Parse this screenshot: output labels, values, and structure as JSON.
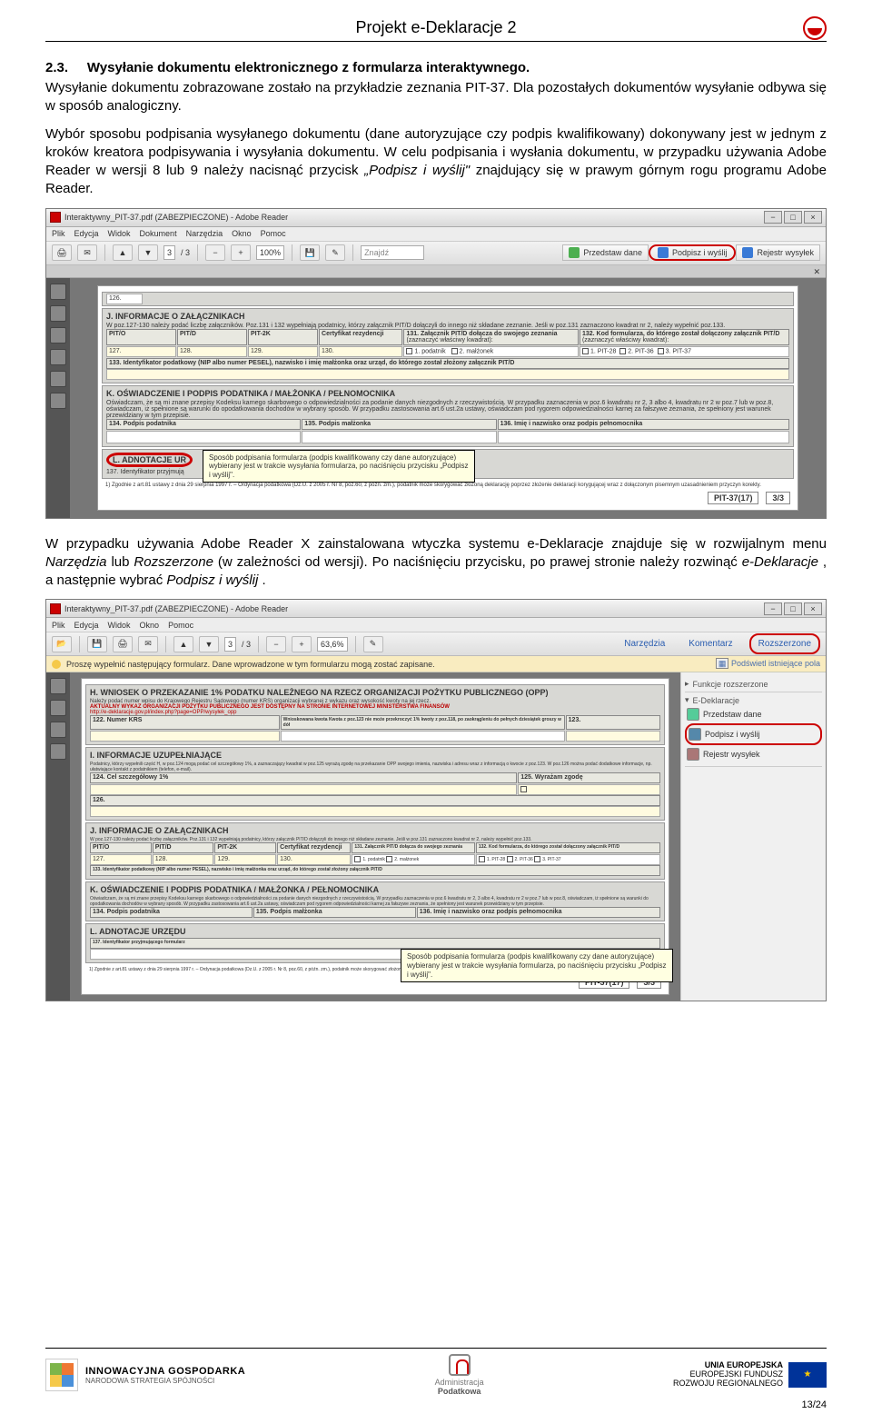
{
  "header": {
    "title": "Projekt e-Deklaracje 2"
  },
  "section": {
    "number": "2.3.",
    "title": "Wysyłanie dokumentu elektronicznego z formularza interaktywnego."
  },
  "para1": "Wysyłanie dokumentu zobrazowane zostało na przykładzie zeznania PIT-37. Dla pozostałych dokumentów wysyłanie odbywa się w sposób analogiczny.",
  "para2_a": "Wybór sposobu podpisania wysyłanego dokumentu (dane autoryzujące czy podpis kwalifikowany) dokonywany jest w jednym z kroków kreatora podpisywania i wysyłania dokumentu. W celu podpisania i wysłania dokumentu, w przypadku używania Adobe Reader w wersji 8 lub 9 należy nacisnąć przycisk ",
  "para2_b": " znajdujący się w prawym górnym rogu programu Adobe Reader.",
  "para2_italic": "„Podpisz i wyślij\"",
  "para3_a": "W przypadku używania Adobe Reader X zainstalowana wtyczka systemu e-Deklaracje znajduje się w rozwijalnym menu ",
  "para3_na": "Narzędzia",
  "para3_b": " lub ",
  "para3_ro": "Rozszerzone",
  "para3_c": " (w zależności od wersji). Po naciśnięciu przycisku, po prawej stronie należy rozwinąć ",
  "para3_ed": "e-Deklaracje",
  "para3_d": ", a następnie wybrać ",
  "para3_pw": "Podpisz i wyślij",
  "para3_e": ".",
  "app1": {
    "title": "Interaktywny_PIT-37.pdf (ZABEZPIECZONE) - Adobe Reader",
    "menu": [
      "Plik",
      "Edycja",
      "Widok",
      "Dokument",
      "Narzędzia",
      "Okno",
      "Pomoc"
    ],
    "page_cur": "3",
    "page_total": "/ 3",
    "zoom": "100%",
    "find": "Znajdź",
    "chips": {
      "przedstaw": "Przedstaw dane",
      "podpisz": "Podpisz i wyślij",
      "rejestr": "Rejestr wysyłek"
    },
    "cell126": "126.",
    "secJ_hd": "J. INFORMACJE O ZAŁĄCZNIKACH",
    "secJ_sub": "W poz.127-130 należy podać liczbę załączników. Poz.131 i 132 wypełniają podatnicy, którzy załącznik PIT/D dołączyli do innego niż składane zeznanie. Jeśli w poz.131 zaznaczono kwadrat nr 2, należy wypełnić poz.133.",
    "j_cells": {
      "pito": "PIT/O",
      "pitd": "PIT/D",
      "pit2k": "PIT-2K",
      "cert": "Certyfikat rezydencji",
      "c131": "131. Załącznik PIT/D dołącza do swojego zeznania",
      "c131s": "(zaznaczyć właściwy kwadrat):",
      "c132": "132. Kod formularza, do którego został dołączony załącznik PIT/D",
      "c132s": "(zaznaczyć właściwy kwadrat):",
      "c127": "127.",
      "c128": "128.",
      "c129": "129.",
      "c130": "130.",
      "opt1": "1. podatnik",
      "opt2": "2. małżonek",
      "optA": "1. PIT-28",
      "optB": "2. PIT-36",
      "optC": "3. PIT-37",
      "c133": "133. Identyfikator podatkowy (NIP albo numer PESEL), nazwisko i imię małżonka oraz urząd, do którego został złożony załącznik PIT/D"
    },
    "secK_hd": "K. OŚWIADCZENIE I PODPIS PODATNIKA / MAŁŻONKA / PEŁNOMOCNIKA",
    "secK_sub": "Oświadczam, że są mi znane przepisy Kodeksu karnego skarbowego o odpowiedzialności za podanie danych niezgodnych z rzeczywistością. W przypadku zaznaczenia w poz.6 kwadratu nr 2, 3 albo 4, kwadratu nr 2 w poz.7 lub w poz.8, oświadczam, iż spełnione są warunki do opodatkowania dochodów w wybrany sposób. W przypadku zastosowania art.6 ust.2a ustawy, oświadczam pod rygorem odpowiedzialności karnej za fałszywe zeznania, że spełniony jest warunek przewidziany w tym przepisie.",
    "k134": "134. Podpis podatnika",
    "k135": "135. Podpis małżonka",
    "k136": "136. Imię i nazwisko oraz podpis pełnomocnika",
    "secL_hd": "L. ADNOTACJE UR",
    "l137": "137. Identyfikator przyjmują",
    "tooltip": "Sposób podpisania formularza (podpis kwalifikowany czy dane autoryzujące) wybierany jest w trakcie wysyłania formularza, po naciśnięciu przycisku „Podpisz i wyślij\".",
    "footnote": "1) Zgodnie z art.81 ustawy z dnia 29 sierpnia 1997 r. – Ordynacja podatkowa (Dz.U. z 2005 r. Nr 8, poz.60, z późn. zm.), podatnik może skorygować złożoną deklarację poprzez złożenie deklaracji korygującej wraz z dołączonym pisemnym uzasadnieniem przyczyn korekty.",
    "pit_tag": "PIT-37(17)",
    "pit_pg": "3/3"
  },
  "app2": {
    "title": "Interaktywny_PIT-37.pdf (ZABEZPIECZONE) - Adobe Reader",
    "menu": [
      "Plik",
      "Edycja",
      "Widok",
      "Okno",
      "Pomoc"
    ],
    "page_cur": "3",
    "page_total": "/ 3",
    "zoom": "63,6%",
    "info": "Proszę wypełnić następujący formularz. Dane wprowadzone w tym formularzu mogą zostać zapisane.",
    "highlight": "Podświetl istniejące pola",
    "links": {
      "narz": "Narzędzia",
      "kom": "Komentarz",
      "roz": "Rozszerzone"
    },
    "rp": {
      "fr": "Funkcje rozszerzone",
      "ed": "E-Deklaracje",
      "prz": "Przedstaw dane",
      "pod": "Podpisz i wyślij",
      "rej": "Rejestr wysyłek"
    },
    "secH_hd": "H. WNIOSEK O PRZEKAZANIE 1% PODATKU NALEŻNEGO NA RZECZ ORGANIZACJI POŻYTKU PUBLICZNEGO (OPP)",
    "secH_sub": "Należy podać numer wpisu do Krajowego Rejestru Sądowego (numer KRS) organizacji wybranej z wykazu oraz wysokość kwoty na jej rzecz.",
    "secH_red": "AKTUALNY WYKAZ ORGANIZACJI POŻYTKU PUBLICZNEGO JEST DOSTĘPNY NA STRONIE INTERNETOWEJ MINISTERSTWA FINANSÓW",
    "secH_link": "http://e-deklaracje.gov.pl/index.php?page=OPP/wysyłek_opp",
    "h122": "122. Numer KRS",
    "h123": "Wnioskowana kwota\nKwota z poz.123 nie może przekroczyć 1% kwoty z poz.118, po zaokrągleniu do pełnych dziesiątek groszy w dół",
    "h123n": "123.",
    "secI_hd": "I. INFORMACJE UZUPEŁNIAJĄCE",
    "secI_sub": "Podatnicy, którzy wypełnili część H, w poz.124 mogą podać cel szczegółowy 1%, a zaznaczający kwadrat w poz.125 wyrażą zgodę na przekazanie OPP swojego imienia, nazwiska i adresu wraz z informacją o kwocie z poz.123. W poz.126 można podać dodatkowe informacje, np. ułatwiające kontakt z podatnikiem (telefon, e-mail).",
    "i124": "124. Cel szczegółowy 1%",
    "i125": "125. Wyrażam zgodę",
    "i126": "126.",
    "secJ_hd": "J. INFORMACJE O ZAŁĄCZNIKACH",
    "secK_hd": "K. OŚWIADCZENIE I PODPIS PODATNIKA / MAŁŻONKA / PEŁNOMOCNIKA",
    "secL_hd": "L. ADNOTACJE URZĘDU",
    "l137": "137. Identyfikator przyjmującego formularz",
    "pit_tag": "PIT-37(17)",
    "pit_pg": "3/3"
  },
  "footer": {
    "ig_title": "INNOWACYJNA GOSPODARKA",
    "ig_sub": "NARODOWA STRATEGIA SPÓJNOŚCI",
    "ap_l1": "Administracja",
    "ap_l2": "Podatkowa",
    "eu_l1": "UNIA EUROPEJSKA",
    "eu_l2": "EUROPEJSKI FUNDUSZ",
    "eu_l3": "ROZWOJU REGIONALNEGO",
    "pagenum": "13/24"
  }
}
